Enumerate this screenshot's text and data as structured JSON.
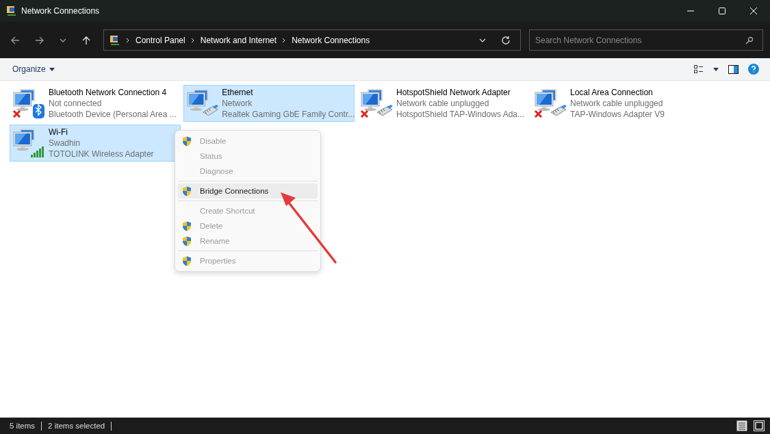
{
  "window": {
    "title": "Network Connections"
  },
  "breadcrumb": [
    "Control Panel",
    "Network and Internet",
    "Network Connections"
  ],
  "search": {
    "placeholder": "Search Network Connections"
  },
  "toolbar": {
    "organize": "Organize"
  },
  "connections": [
    {
      "name": "Bluetooth Network Connection 4",
      "status": "Not connected",
      "device": "Bluetooth Device (Personal Area ...",
      "kind": "bluetooth",
      "disconnected": true,
      "selected": false
    },
    {
      "name": "Ethernet",
      "status": "Network",
      "device": "Realtek Gaming GbE Family Contr...",
      "kind": "ethernet",
      "disconnected": false,
      "selected": true
    },
    {
      "name": "HotspotShield Network Adapter",
      "status": "Network cable unplugged",
      "device": "HotspotShield TAP-Windows Ada...",
      "kind": "ethernet",
      "disconnected": true,
      "selected": false
    },
    {
      "name": "Local Area Connection",
      "status": "Network cable unplugged",
      "device": "TAP-Windows Adapter V9",
      "kind": "ethernet",
      "disconnected": true,
      "selected": false
    },
    {
      "name": "Wi-Fi",
      "status": "Swadhin",
      "device": "TOTOLINK Wireless Adapter",
      "kind": "wifi",
      "disconnected": false,
      "selected": true
    }
  ],
  "context_menu": [
    {
      "kind": "item",
      "label": "Disable",
      "shield": true,
      "disabled": true,
      "selected": false
    },
    {
      "kind": "item",
      "label": "Status",
      "shield": false,
      "disabled": true,
      "selected": false
    },
    {
      "kind": "item",
      "label": "Diagnose",
      "shield": false,
      "disabled": true,
      "selected": false
    },
    {
      "kind": "separator"
    },
    {
      "kind": "item",
      "label": "Bridge Connections",
      "shield": true,
      "disabled": false,
      "selected": true
    },
    {
      "kind": "separator"
    },
    {
      "kind": "item",
      "label": "Create Shortcut",
      "shield": false,
      "disabled": true,
      "selected": false
    },
    {
      "kind": "item",
      "label": "Delete",
      "shield": true,
      "disabled": true,
      "selected": false
    },
    {
      "kind": "item",
      "label": "Rename",
      "shield": true,
      "disabled": true,
      "selected": false
    },
    {
      "kind": "separator"
    },
    {
      "kind": "item",
      "label": "Properties",
      "shield": true,
      "disabled": true,
      "selected": false
    }
  ],
  "status_bar": {
    "count": "5 items",
    "selection": "2 items selected"
  }
}
